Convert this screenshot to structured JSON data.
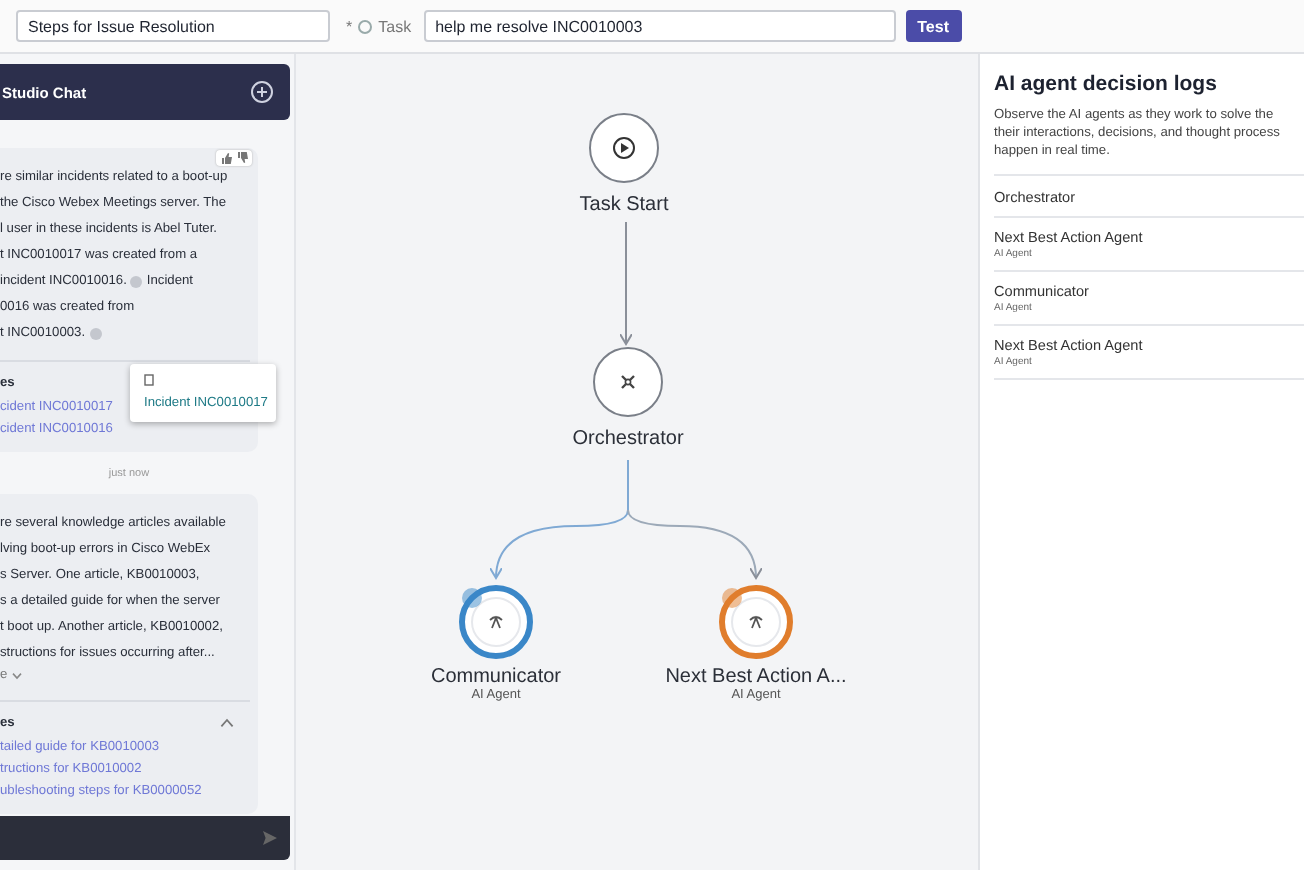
{
  "topbar": {
    "name_field": {
      "value": "Steps for Issue Resolution"
    },
    "task_label": "Task",
    "required_mark": "*",
    "task_field": {
      "value": "help me resolve INC0010003"
    },
    "test_button": "Test"
  },
  "chat": {
    "title": "Studio Chat",
    "messages": [
      {
        "lines": [
          "re similar incidents related to a boot-up",
          "the Cisco Webex Meetings server. The",
          "l user in these incidents is Abel Tuter.",
          "t INC0010017 was created from a",
          {
            "segments": [
              {
                "kind": "text",
                "text": "incident INC0010016."
              },
              {
                "kind": "info"
              },
              {
                "kind": "text",
                "text": "Incident"
              }
            ]
          },
          "0016 was created from",
          {
            "segments": [
              {
                "kind": "text",
                "text": "t INC0010003."
              },
              {
                "kind": "info"
              }
            ]
          }
        ],
        "feedback": true,
        "references_title": "es",
        "references": [
          "cident INC0010017",
          "cident INC0010016"
        ],
        "tooltip": "Incident INC0010017"
      },
      {
        "lines": [
          "re several knowledge articles available",
          "lving boot-up errors in Cisco WebEx",
          "s Server. One article, KB0010003,",
          "s a detailed guide for when the server",
          "t boot up. Another article, KB0010002,",
          "structions for issues occurring after..."
        ],
        "feedback": false,
        "more": "e",
        "references_title": "es",
        "references": [
          "tailed guide for KB0010003",
          "tructions for KB0010002",
          "ubleshooting steps for KB0000052"
        ]
      }
    ],
    "timestamp": "just now"
  },
  "flow": {
    "nodes": [
      {
        "kind": "start",
        "label": "Task Start"
      },
      {
        "kind": "orchestrator",
        "label": "Orchestrator"
      },
      {
        "kind": "agent",
        "label": "Communicator",
        "subtitle": "AI Agent",
        "color": "#3a87c8"
      },
      {
        "kind": "agent",
        "label": "Next Best Action A...",
        "subtitle": "AI Agent",
        "color": "#e07d2c"
      }
    ]
  },
  "logs": {
    "title": "AI agent decision logs",
    "description": [
      "Observe the AI agents as they work to solve the",
      "their interactions, decisions, and thought process",
      "happen in real time."
    ],
    "items": [
      {
        "name": "Orchestrator"
      },
      {
        "name": "Next Best Action Agent",
        "subtitle": "AI Agent"
      },
      {
        "name": "Communicator",
        "subtitle": "AI Agent"
      },
      {
        "name": "Next Best Action Agent",
        "subtitle": "AI Agent"
      }
    ]
  }
}
